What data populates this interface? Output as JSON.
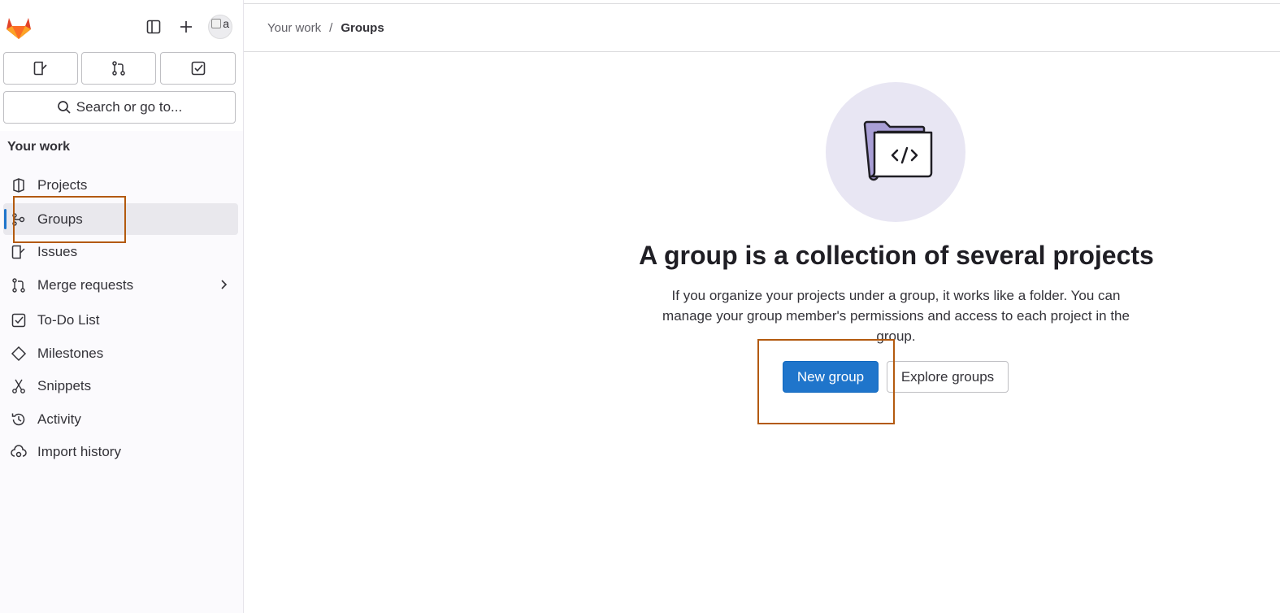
{
  "sidebar": {
    "avatar_alt": "a",
    "search_label": "Search or go to...",
    "section_title": "Your work",
    "items": [
      {
        "label": "Projects"
      },
      {
        "label": "Groups"
      },
      {
        "label": "Issues"
      },
      {
        "label": "Merge requests"
      },
      {
        "label": "To-Do List"
      },
      {
        "label": "Milestones"
      },
      {
        "label": "Snippets"
      },
      {
        "label": "Activity"
      },
      {
        "label": "Import history"
      }
    ]
  },
  "breadcrumb": {
    "parent": "Your work",
    "separator": "/",
    "current": "Groups"
  },
  "empty_state": {
    "title": "A group is a collection of several projects",
    "description": "If you organize your projects under a group, it works like a folder. You can manage your group member's permissions and access to each project in the group.",
    "primary_button": "New group",
    "secondary_button": "Explore groups"
  },
  "colors": {
    "accent": "#1f75cb",
    "highlight": "#b35a0f",
    "illustration_bg": "#e8e6f3"
  }
}
